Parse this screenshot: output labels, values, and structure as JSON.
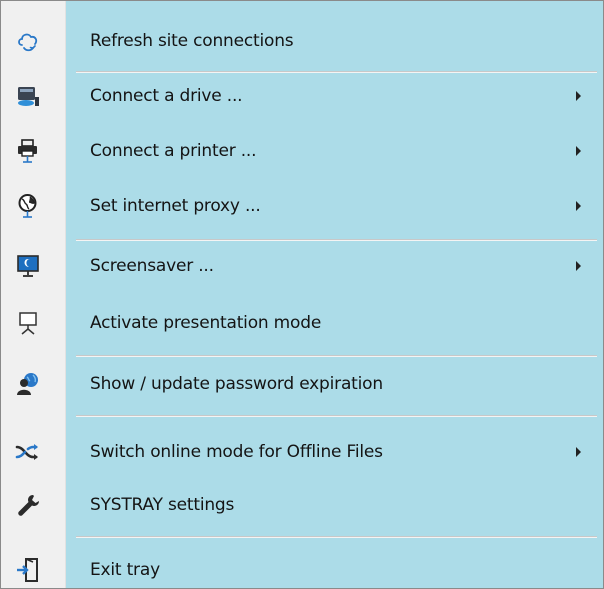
{
  "menu": {
    "items": [
      {
        "label": "Refresh site connections",
        "icon": "refresh-cloud-icon",
        "has_submenu": false
      },
      {
        "label": "Connect a drive ...",
        "icon": "network-drive-icon",
        "has_submenu": true
      },
      {
        "label": "Connect a printer ...",
        "icon": "network-printer-icon",
        "has_submenu": true
      },
      {
        "label": "Set internet proxy ...",
        "icon": "globe-network-icon",
        "has_submenu": true
      },
      {
        "label": "Screensaver ...",
        "icon": "monitor-moon-icon",
        "has_submenu": true
      },
      {
        "label": "Activate presentation mode",
        "icon": "presentation-easel-icon",
        "has_submenu": false
      },
      {
        "label": "Show / update password expiration",
        "icon": "user-globe-icon",
        "has_submenu": false
      },
      {
        "label": "Switch online mode for Offline Files",
        "icon": "shuffle-arrows-icon",
        "has_submenu": true
      },
      {
        "label": "SYSTRAY settings",
        "icon": "wrench-icon",
        "has_submenu": false
      },
      {
        "label": "Exit tray",
        "icon": "exit-door-icon",
        "has_submenu": false
      }
    ]
  },
  "colors": {
    "highlight": "#acdce8",
    "gutter": "#f0f0f0",
    "separator": "#c8c8c8",
    "text": "#141414"
  }
}
